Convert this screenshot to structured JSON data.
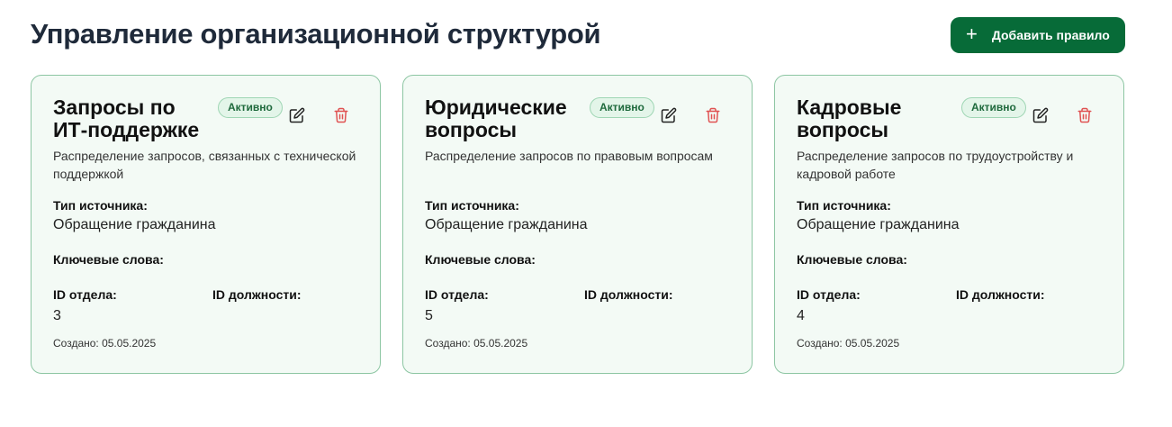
{
  "header": {
    "title": "Управление организационной структурой",
    "add_button_label": "Добавить правило",
    "add_button_icon": "plus-icon"
  },
  "labels": {
    "source_type": "Тип источника:",
    "keywords": "Ключевые слова:",
    "department_id": "ID отдела:",
    "position_id": "ID должности:"
  },
  "colors": {
    "accent": "#076b38",
    "card_bg": "#f3faf5",
    "card_border": "#8dc6a3",
    "badge_text": "#1f6a3d",
    "delete": "#e05252"
  },
  "cards": [
    {
      "title": "Запросы по ИТ-поддержке",
      "status": "Активно",
      "description": "Распределение запросов, связанных с технической поддержкой",
      "source_type": "Обращение гражданина",
      "keywords": "",
      "department_id": "3",
      "position_id": "",
      "created": "Создано: 05.05.2025"
    },
    {
      "title": "Юридические вопросы",
      "status": "Активно",
      "description": "Распределение запросов по правовым вопросам",
      "source_type": "Обращение гражданина",
      "keywords": "",
      "department_id": "5",
      "position_id": "",
      "created": "Создано: 05.05.2025"
    },
    {
      "title": "Кадровые вопросы",
      "status": "Активно",
      "description": "Распределение запросов по трудоустройству и кадровой работе",
      "source_type": "Обращение гражданина",
      "keywords": "",
      "department_id": "4",
      "position_id": "",
      "created": "Создано: 05.05.2025"
    }
  ]
}
